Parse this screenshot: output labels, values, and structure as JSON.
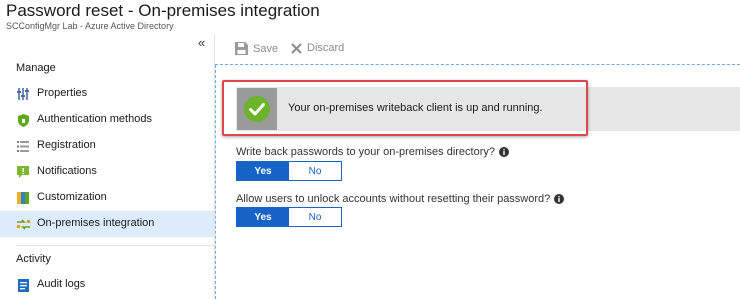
{
  "blade": {
    "title": "Password reset - On-premises integration",
    "subtitle": "SCConfigMgr Lab - Azure Active Directory"
  },
  "sidebar": {
    "sections": [
      {
        "title": "Manage"
      },
      {
        "title": "Activity"
      }
    ],
    "manage_items": [
      {
        "label": "Properties",
        "icon": "properties-icon"
      },
      {
        "label": "Authentication methods",
        "icon": "shield-icon"
      },
      {
        "label": "Registration",
        "icon": "list-icon"
      },
      {
        "label": "Notifications",
        "icon": "notification-icon"
      },
      {
        "label": "Customization",
        "icon": "customization-icon"
      },
      {
        "label": "On-premises integration",
        "icon": "sync-icon",
        "active": true
      }
    ],
    "activity_items": [
      {
        "label": "Audit logs",
        "icon": "audit-logs-icon"
      }
    ]
  },
  "toolbar": {
    "save_label": "Save",
    "discard_label": "Discard"
  },
  "status": {
    "message": "Your on-premises writeback client is up and running.",
    "icon": "checkmark-icon"
  },
  "settings": {
    "writeback": {
      "question": "Write back passwords to your on-premises directory?",
      "yes_label": "Yes",
      "no_label": "No",
      "selected": "Yes"
    },
    "unlock": {
      "question": "Allow users to unlock accounts without resetting their password?",
      "yes_label": "Yes",
      "no_label": "No",
      "selected": "Yes"
    }
  },
  "colors": {
    "accent": "#1563c7",
    "active_nav": "#dcecfa",
    "highlight": "#e0474c",
    "success": "#6bb42b"
  }
}
